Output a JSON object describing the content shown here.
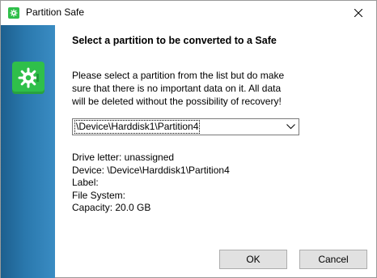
{
  "window": {
    "title": "Partition Safe",
    "app_icon": "safe-icon",
    "close_icon": "close-icon"
  },
  "side_panel": {
    "logo_icon": "safe-icon",
    "colors": {
      "panel": "#2a78ad",
      "logo": "#2fbf4a"
    }
  },
  "main": {
    "heading": "Select a partition to be converted to a Safe",
    "description_lines": [
      "Please select a partition from the list but do make",
      "sure that there is no important data on it. All data",
      "will be deleted without the possibility of recovery!"
    ],
    "partition_select": {
      "selected": "\\Device\\Harddisk1\\Partition4",
      "arrow_icon": "chevron-down-icon"
    },
    "info": {
      "drive_letter": "Drive letter: unassigned",
      "device": "Device: \\Device\\Harddisk1\\Partition4",
      "label": "Label:",
      "file_system": "File System:",
      "capacity": "Capacity: 20.0 GB"
    }
  },
  "buttons": {
    "ok": "OK",
    "cancel": "Cancel"
  }
}
